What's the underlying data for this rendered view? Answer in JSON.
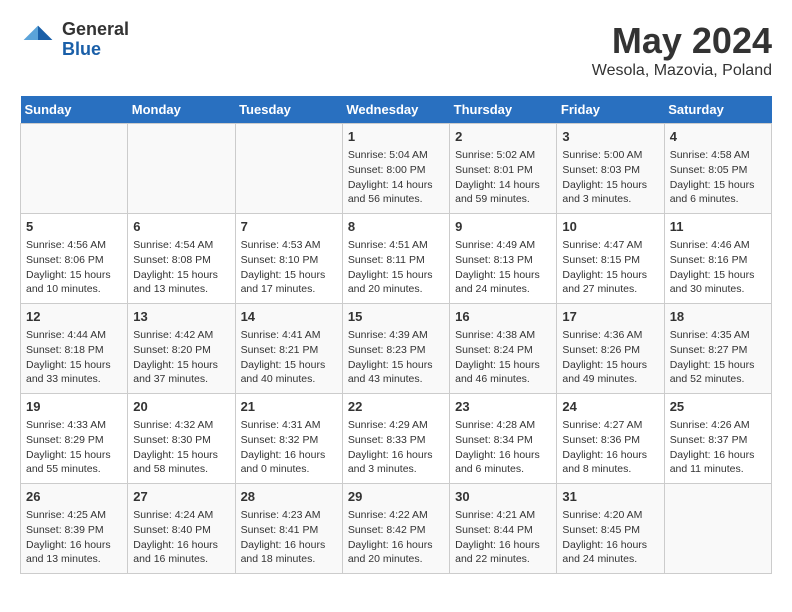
{
  "logo": {
    "general": "General",
    "blue": "Blue"
  },
  "header": {
    "title": "May 2024",
    "subtitle": "Wesola, Mazovia, Poland"
  },
  "days_of_week": [
    "Sunday",
    "Monday",
    "Tuesday",
    "Wednesday",
    "Thursday",
    "Friday",
    "Saturday"
  ],
  "weeks": [
    [
      {
        "day": "",
        "info": ""
      },
      {
        "day": "",
        "info": ""
      },
      {
        "day": "",
        "info": ""
      },
      {
        "day": "1",
        "info": "Sunrise: 5:04 AM\nSunset: 8:00 PM\nDaylight: 14 hours\nand 56 minutes."
      },
      {
        "day": "2",
        "info": "Sunrise: 5:02 AM\nSunset: 8:01 PM\nDaylight: 14 hours\nand 59 minutes."
      },
      {
        "day": "3",
        "info": "Sunrise: 5:00 AM\nSunset: 8:03 PM\nDaylight: 15 hours\nand 3 minutes."
      },
      {
        "day": "4",
        "info": "Sunrise: 4:58 AM\nSunset: 8:05 PM\nDaylight: 15 hours\nand 6 minutes."
      }
    ],
    [
      {
        "day": "5",
        "info": "Sunrise: 4:56 AM\nSunset: 8:06 PM\nDaylight: 15 hours\nand 10 minutes."
      },
      {
        "day": "6",
        "info": "Sunrise: 4:54 AM\nSunset: 8:08 PM\nDaylight: 15 hours\nand 13 minutes."
      },
      {
        "day": "7",
        "info": "Sunrise: 4:53 AM\nSunset: 8:10 PM\nDaylight: 15 hours\nand 17 minutes."
      },
      {
        "day": "8",
        "info": "Sunrise: 4:51 AM\nSunset: 8:11 PM\nDaylight: 15 hours\nand 20 minutes."
      },
      {
        "day": "9",
        "info": "Sunrise: 4:49 AM\nSunset: 8:13 PM\nDaylight: 15 hours\nand 24 minutes."
      },
      {
        "day": "10",
        "info": "Sunrise: 4:47 AM\nSunset: 8:15 PM\nDaylight: 15 hours\nand 27 minutes."
      },
      {
        "day": "11",
        "info": "Sunrise: 4:46 AM\nSunset: 8:16 PM\nDaylight: 15 hours\nand 30 minutes."
      }
    ],
    [
      {
        "day": "12",
        "info": "Sunrise: 4:44 AM\nSunset: 8:18 PM\nDaylight: 15 hours\nand 33 minutes."
      },
      {
        "day": "13",
        "info": "Sunrise: 4:42 AM\nSunset: 8:20 PM\nDaylight: 15 hours\nand 37 minutes."
      },
      {
        "day": "14",
        "info": "Sunrise: 4:41 AM\nSunset: 8:21 PM\nDaylight: 15 hours\nand 40 minutes."
      },
      {
        "day": "15",
        "info": "Sunrise: 4:39 AM\nSunset: 8:23 PM\nDaylight: 15 hours\nand 43 minutes."
      },
      {
        "day": "16",
        "info": "Sunrise: 4:38 AM\nSunset: 8:24 PM\nDaylight: 15 hours\nand 46 minutes."
      },
      {
        "day": "17",
        "info": "Sunrise: 4:36 AM\nSunset: 8:26 PM\nDaylight: 15 hours\nand 49 minutes."
      },
      {
        "day": "18",
        "info": "Sunrise: 4:35 AM\nSunset: 8:27 PM\nDaylight: 15 hours\nand 52 minutes."
      }
    ],
    [
      {
        "day": "19",
        "info": "Sunrise: 4:33 AM\nSunset: 8:29 PM\nDaylight: 15 hours\nand 55 minutes."
      },
      {
        "day": "20",
        "info": "Sunrise: 4:32 AM\nSunset: 8:30 PM\nDaylight: 15 hours\nand 58 minutes."
      },
      {
        "day": "21",
        "info": "Sunrise: 4:31 AM\nSunset: 8:32 PM\nDaylight: 16 hours\nand 0 minutes."
      },
      {
        "day": "22",
        "info": "Sunrise: 4:29 AM\nSunset: 8:33 PM\nDaylight: 16 hours\nand 3 minutes."
      },
      {
        "day": "23",
        "info": "Sunrise: 4:28 AM\nSunset: 8:34 PM\nDaylight: 16 hours\nand 6 minutes."
      },
      {
        "day": "24",
        "info": "Sunrise: 4:27 AM\nSunset: 8:36 PM\nDaylight: 16 hours\nand 8 minutes."
      },
      {
        "day": "25",
        "info": "Sunrise: 4:26 AM\nSunset: 8:37 PM\nDaylight: 16 hours\nand 11 minutes."
      }
    ],
    [
      {
        "day": "26",
        "info": "Sunrise: 4:25 AM\nSunset: 8:39 PM\nDaylight: 16 hours\nand 13 minutes."
      },
      {
        "day": "27",
        "info": "Sunrise: 4:24 AM\nSunset: 8:40 PM\nDaylight: 16 hours\nand 16 minutes."
      },
      {
        "day": "28",
        "info": "Sunrise: 4:23 AM\nSunset: 8:41 PM\nDaylight: 16 hours\nand 18 minutes."
      },
      {
        "day": "29",
        "info": "Sunrise: 4:22 AM\nSunset: 8:42 PM\nDaylight: 16 hours\nand 20 minutes."
      },
      {
        "day": "30",
        "info": "Sunrise: 4:21 AM\nSunset: 8:44 PM\nDaylight: 16 hours\nand 22 minutes."
      },
      {
        "day": "31",
        "info": "Sunrise: 4:20 AM\nSunset: 8:45 PM\nDaylight: 16 hours\nand 24 minutes."
      },
      {
        "day": "",
        "info": ""
      }
    ]
  ]
}
